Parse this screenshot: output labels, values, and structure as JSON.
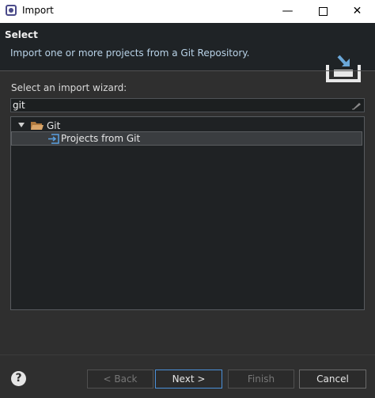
{
  "window": {
    "title": "Import",
    "min_glyph": "—",
    "close_glyph": "✕"
  },
  "header": {
    "title": "Select",
    "description": "Import one or more projects from a Git Repository."
  },
  "wizard": {
    "label": "Select an import wizard:",
    "filter_value": "git"
  },
  "tree": {
    "items": [
      {
        "label": "Git",
        "expanded": true,
        "icon": "folder-icon"
      },
      {
        "label": "Projects from Git",
        "selected": true,
        "icon": "import-projects-icon"
      }
    ]
  },
  "buttons": {
    "back": "< Back",
    "next": "Next >",
    "finish": "Finish",
    "cancel": "Cancel",
    "help": "?"
  },
  "colors": {
    "accent": "#4a90d9",
    "folder": "#d9a56a",
    "header_bg": "#1f2326",
    "body_bg": "#2f2f2f"
  }
}
